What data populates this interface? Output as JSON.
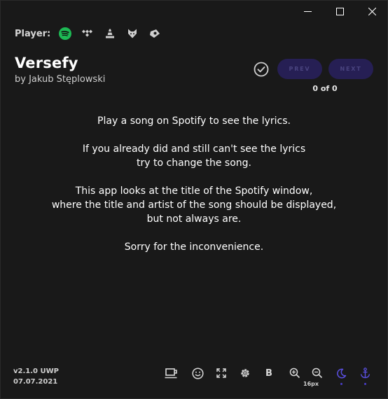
{
  "window": {
    "controls": [
      "minimize",
      "maximize",
      "close"
    ]
  },
  "player": {
    "label": "Player:",
    "options": [
      {
        "name": "Spotify",
        "icon": "spotify-icon",
        "active": true,
        "color": "#1db954"
      },
      {
        "name": "Tidal",
        "icon": "tidal-icon",
        "active": false
      },
      {
        "name": "VLC",
        "icon": "vlc-icon",
        "active": false
      },
      {
        "name": "Foobar",
        "icon": "fox-icon",
        "active": false
      },
      {
        "name": "Groove",
        "icon": "groove-icon",
        "active": false
      }
    ]
  },
  "header": {
    "title": "Versefy",
    "author": "by Jakub Stęplowski",
    "prev_label": "PREV",
    "next_label": "NEXT",
    "counter": "0 of 0"
  },
  "message": {
    "paragraphs": [
      [
        "Play a song on Spotify to see the lyrics."
      ],
      [
        "If you already did and still can't see the lyrics",
        "try to change the song."
      ],
      [
        "This app looks at the title of the Spotify window,",
        "where the title and artist of the song should be displayed,",
        "but not always are."
      ],
      [
        "Sorry for the inconvenience."
      ]
    ]
  },
  "footer": {
    "version": "v2.1.0 UWP",
    "date": "07.07.2021",
    "zoom_label": "16px",
    "accent_color": "#5a4fe0",
    "tools": [
      {
        "icon": "coffee-icon",
        "name": "coffee-button"
      },
      {
        "icon": "smiley-icon",
        "name": "smiley-button"
      },
      {
        "icon": "fullscreen-icon",
        "name": "fullscreen-button"
      },
      {
        "icon": "gear-icon",
        "name": "settings-button"
      },
      {
        "icon": "bold-icon",
        "name": "bold-button",
        "text": "B"
      },
      {
        "icon": "zoom-in-icon",
        "name": "zoom-in-button"
      },
      {
        "icon": "zoom-out-icon",
        "name": "zoom-out-button"
      },
      {
        "icon": "moon-icon",
        "name": "dark-mode-button",
        "active": true
      },
      {
        "icon": "anchor-icon",
        "name": "pin-button",
        "active": true
      }
    ]
  }
}
